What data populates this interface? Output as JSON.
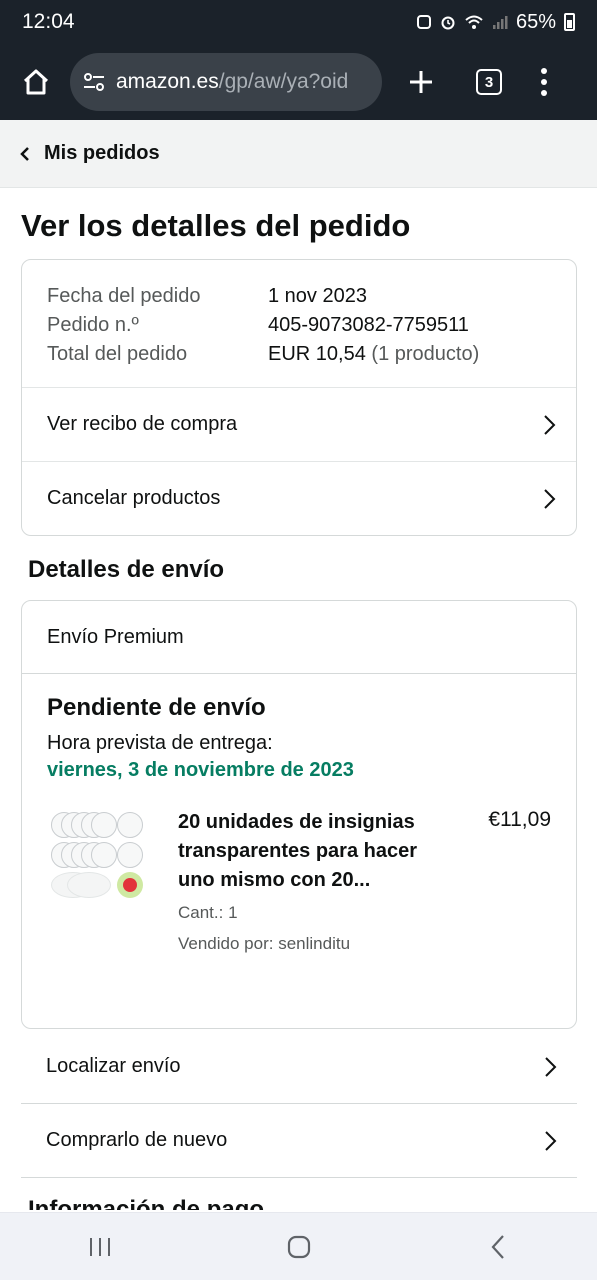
{
  "status_bar": {
    "time": "12:04",
    "battery": "65%"
  },
  "browser": {
    "url_domain": "amazon.es",
    "url_path": "/gp/aw/ya?oid",
    "tab_count": "3"
  },
  "breadcrumb": {
    "label": "Mis pedidos"
  },
  "page": {
    "title": "Ver los detalles del pedido"
  },
  "summary": {
    "rows": [
      {
        "label": "Fecha del pedido",
        "value": "1 nov 2023"
      },
      {
        "label": "Pedido n.º",
        "value": "405-9073082-7759511"
      },
      {
        "label": "Total del pedido",
        "value": "EUR 10,54",
        "extra": "(1 producto)"
      }
    ],
    "links": [
      "Ver recibo de compra",
      "Cancelar productos"
    ]
  },
  "shipping": {
    "section_title": "Detalles de envío",
    "method": "Envío Premium",
    "status": "Pendiente de envío",
    "eta_label": "Hora prevista de entrega:",
    "eta_date": "viernes, 3 de noviembre de 2023",
    "item": {
      "title": "20 unidades de insignias transparentes para hacer uno mismo con 20...",
      "qty": "Cant.: 1",
      "seller": "Vendido por: senlinditu",
      "price": "€11,09"
    }
  },
  "actions": [
    "Localizar envío",
    "Comprarlo de nuevo"
  ],
  "next_section_peek": "Información de pago",
  "colors": {
    "chrome": "#1b222a",
    "eta_green": "#067d62",
    "muted": "#565959"
  }
}
